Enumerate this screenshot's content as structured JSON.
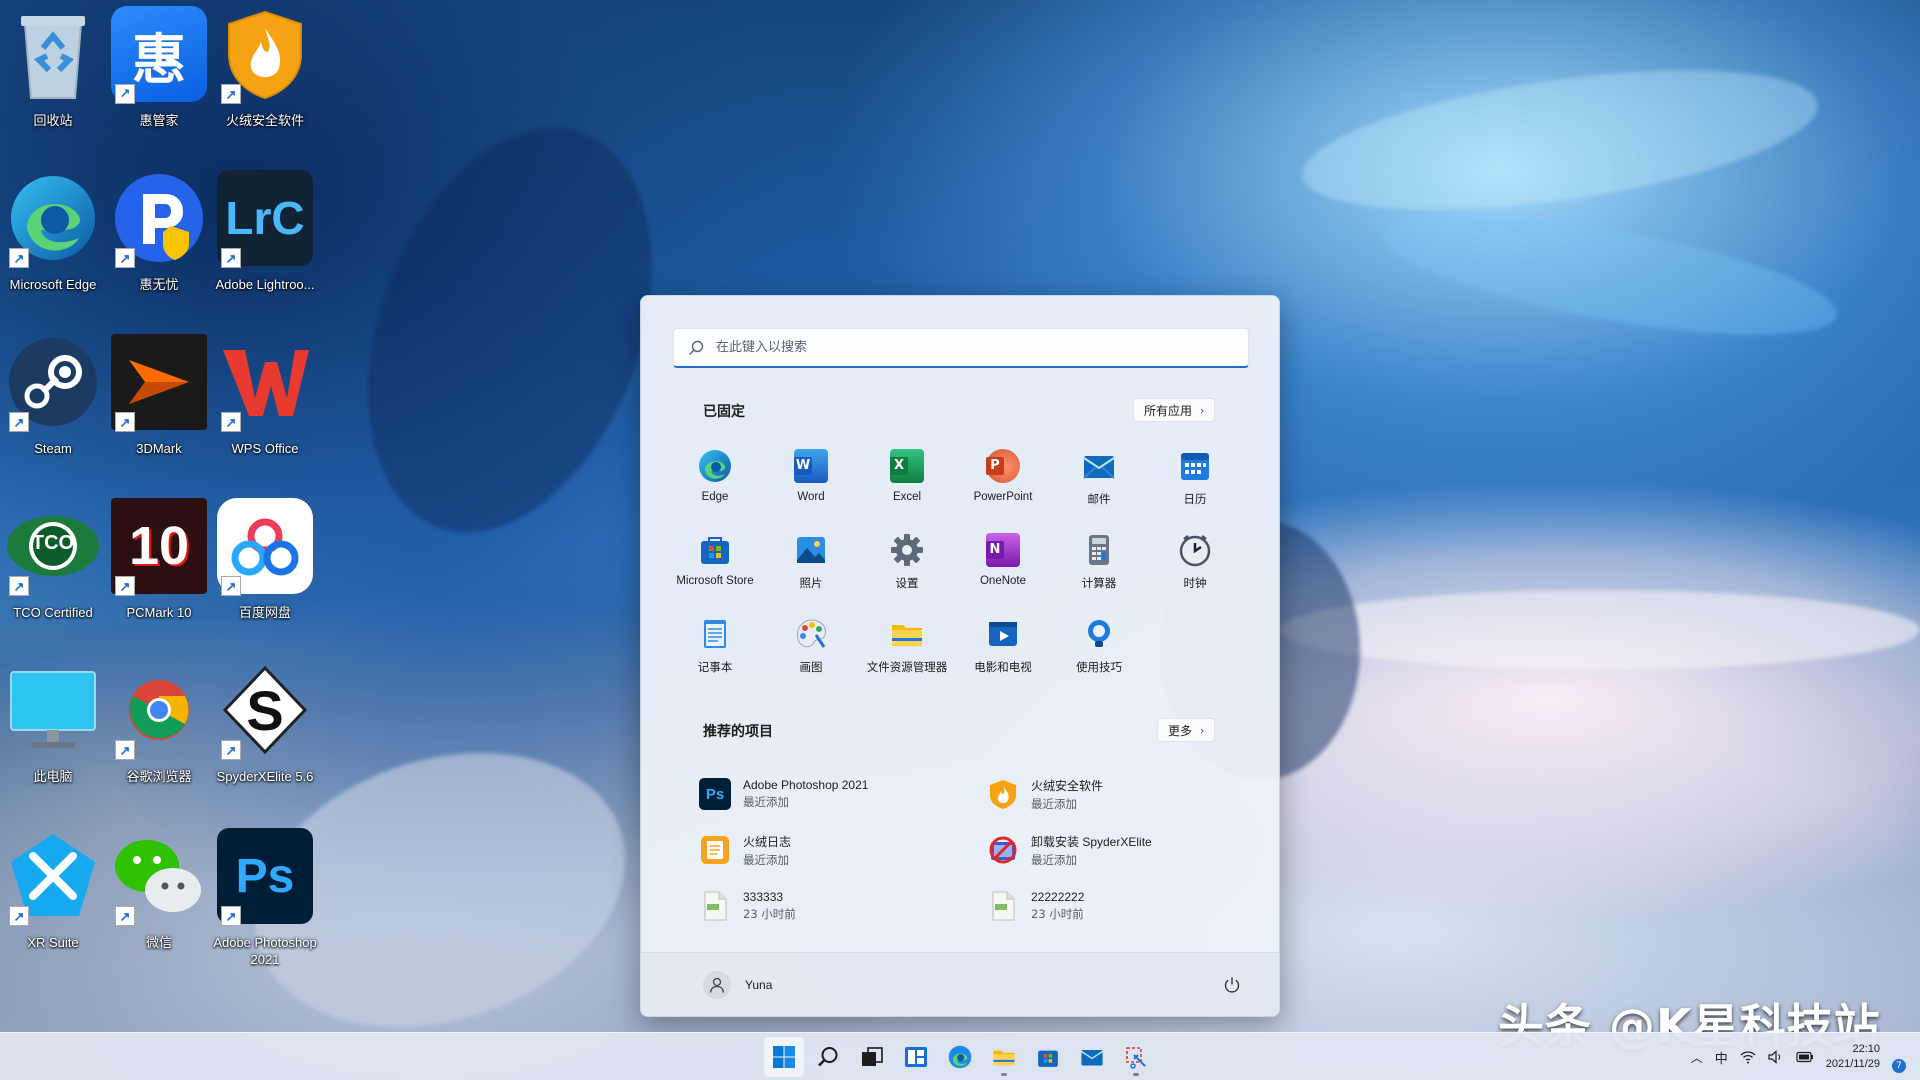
{
  "desktop": {
    "icons": [
      {
        "label": "回收站",
        "icon": "recycle-bin-icon"
      },
      {
        "label": "惠管家",
        "icon": "hui-manager-icon",
        "glyph": "惠"
      },
      {
        "label": "火绒安全软件",
        "icon": "huorong-security-icon"
      },
      {
        "label": "Microsoft Edge",
        "icon": "edge-icon"
      },
      {
        "label": "惠无忧",
        "icon": "hui-wuyou-icon"
      },
      {
        "label": "Adobe Lightroo...",
        "icon": "lightroom-icon",
        "glyph": "LrC"
      },
      {
        "label": "Steam",
        "icon": "steam-icon"
      },
      {
        "label": "3DMark",
        "icon": "3dmark-icon"
      },
      {
        "label": "WPS Office",
        "icon": "wps-office-icon"
      },
      {
        "label": "TCO Certified",
        "icon": "tco-certified-icon",
        "glyph": "TCO"
      },
      {
        "label": "PCMark 10",
        "icon": "pcmark-icon",
        "glyph": "10"
      },
      {
        "label": "百度网盘",
        "icon": "baidu-netdisk-icon"
      },
      {
        "label": "此电脑",
        "icon": "this-pc-icon"
      },
      {
        "label": "谷歌浏览器",
        "icon": "chrome-icon"
      },
      {
        "label": "SpyderXElite 5.6",
        "icon": "spyderx-icon",
        "glyph": "S"
      },
      {
        "label": "XR Suite",
        "icon": "xr-suite-icon"
      },
      {
        "label": "微信",
        "icon": "wechat-icon"
      },
      {
        "label": "Adobe Photoshop 2021",
        "icon": "photoshop-icon",
        "glyph": "Ps"
      }
    ]
  },
  "start_menu": {
    "search_placeholder": "在此键入以搜索",
    "pinned_title": "已固定",
    "all_apps_label": "所有应用",
    "pinned": [
      {
        "label": "Edge",
        "icon": "edge-icon"
      },
      {
        "label": "Word",
        "icon": "word-icon",
        "glyph": "W"
      },
      {
        "label": "Excel",
        "icon": "excel-icon",
        "glyph": "X"
      },
      {
        "label": "PowerPoint",
        "icon": "powerpoint-icon",
        "glyph": "P"
      },
      {
        "label": "邮件",
        "icon": "mail-icon"
      },
      {
        "label": "日历",
        "icon": "calendar-icon"
      },
      {
        "label": "Microsoft Store",
        "icon": "store-icon"
      },
      {
        "label": "照片",
        "icon": "photos-icon"
      },
      {
        "label": "设置",
        "icon": "settings-gear-icon"
      },
      {
        "label": "OneNote",
        "icon": "onenote-icon",
        "glyph": "N"
      },
      {
        "label": "计算器",
        "icon": "calculator-icon"
      },
      {
        "label": "时钟",
        "icon": "clock-icon"
      },
      {
        "label": "记事本",
        "icon": "notepad-icon"
      },
      {
        "label": "画图",
        "icon": "paint-icon"
      },
      {
        "label": "文件资源管理器",
        "icon": "file-explorer-icon"
      },
      {
        "label": "电影和电视",
        "icon": "movies-tv-icon"
      },
      {
        "label": "使用技巧",
        "icon": "tips-icon"
      }
    ],
    "recommended_title": "推荐的项目",
    "more_label": "更多",
    "recommended": [
      {
        "name": "Adobe Photoshop 2021",
        "sub": "最近添加",
        "icon": "photoshop-icon"
      },
      {
        "name": "火绒安全软件",
        "sub": "最近添加",
        "icon": "huorong-security-icon"
      },
      {
        "name": "火绒日志",
        "sub": "最近添加",
        "icon": "huorong-log-icon"
      },
      {
        "name": "卸载安装 SpyderXElite",
        "sub": "最近添加",
        "icon": "uninstall-icon"
      },
      {
        "name": "333333",
        "sub": "23 小时前",
        "icon": "image-file-icon"
      },
      {
        "name": "22222222",
        "sub": "23 小时前",
        "icon": "image-file-icon"
      }
    ],
    "user_name": "Yuna"
  },
  "taskbar": {
    "icons": [
      "windows-start-icon",
      "search-icon",
      "task-view-icon",
      "widgets-icon",
      "edge-icon",
      "file-explorer-icon",
      "store-icon",
      "mail-icon",
      "snipping-tool-icon"
    ],
    "ime_label": "中",
    "time": "22:10",
    "date": "2021/11/29",
    "notification_count": "7"
  },
  "watermark": "头条 @K星科技站",
  "colors": {
    "accent": "#1f6fd1"
  }
}
